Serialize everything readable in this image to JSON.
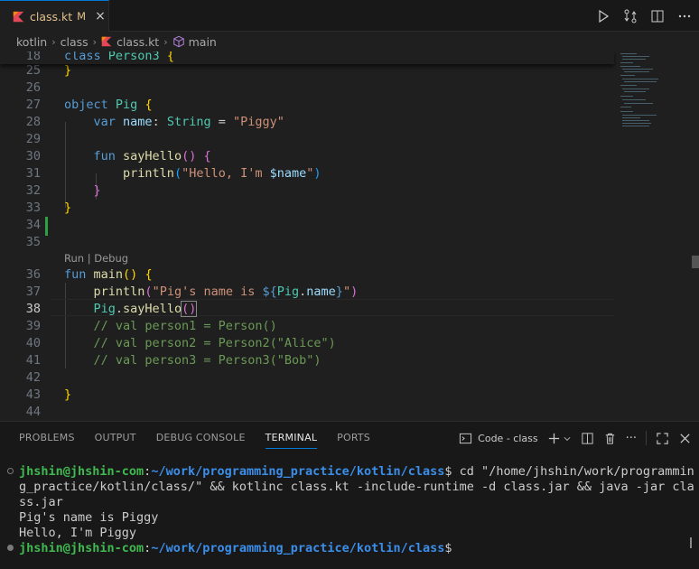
{
  "tab": {
    "filename": "class.kt",
    "modified": "M",
    "close": "×"
  },
  "breadcrumb": [
    "kotlin",
    "class",
    "class.kt",
    "main"
  ],
  "editor": {
    "sticky_line": {
      "num": "18",
      "text": "class Person3 {"
    },
    "codelens": "Run | Debug",
    "lines": [
      {
        "num": "25",
        "code": "}"
      },
      {
        "num": "26",
        "code": ""
      },
      {
        "num": "27",
        "code": "object Pig {"
      },
      {
        "num": "28",
        "code": "    var name: String = \"Piggy\""
      },
      {
        "num": "29",
        "code": ""
      },
      {
        "num": "30",
        "code": "    fun sayHello() {"
      },
      {
        "num": "31",
        "code": "        println(\"Hello, I'm $name\")"
      },
      {
        "num": "32",
        "code": "    }"
      },
      {
        "num": "33",
        "code": "}"
      },
      {
        "num": "34",
        "code": ""
      },
      {
        "num": "35",
        "code": ""
      },
      {
        "num": "36",
        "code": "fun main() {"
      },
      {
        "num": "37",
        "code": "    println(\"Pig's name is ${Pig.name}\")"
      },
      {
        "num": "38",
        "code": "    Pig.sayHello()"
      },
      {
        "num": "39",
        "code": "    // val person1 = Person()"
      },
      {
        "num": "40",
        "code": "    // val person2 = Person2(\"Alice\")"
      },
      {
        "num": "41",
        "code": "    // val person3 = Person3(\"Bob\")"
      },
      {
        "num": "42",
        "code": ""
      },
      {
        "num": "43",
        "code": "}"
      },
      {
        "num": "44",
        "code": ""
      }
    ],
    "active_line": "38"
  },
  "panel": {
    "tabs": [
      "PROBLEMS",
      "OUTPUT",
      "DEBUG CONSOLE",
      "TERMINAL",
      "PORTS"
    ],
    "active_tab": "TERMINAL",
    "terminal_name": "Code - class",
    "more": "···"
  },
  "terminal": {
    "user": "jhshin@jhshin-com",
    "path": "~/work/programming_practice/kotlin/class",
    "command_line1": "$ cd \"/home/jhshin/work/programmin",
    "command_line2": "g_practice/kotlin/class/\" && kotlinc class.kt -include-runtime -d class.jar && java -jar cla",
    "command_line3": "ss.jar",
    "output1": "Pig's name is Piggy",
    "output2": "Hello, I'm Piggy",
    "prompt_end": "$"
  },
  "colors": {
    "keyword": "#569cd6",
    "type": "#4ec9b0",
    "function": "#dcdcaa",
    "string": "#ce9178",
    "comment": "#6a9955",
    "accent": "#0078d4",
    "modified": "#e2c08d"
  }
}
